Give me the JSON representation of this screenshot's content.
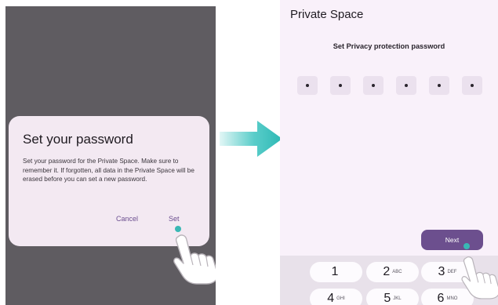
{
  "left_screen": {
    "dialog": {
      "title": "Set your password",
      "body": "Set your password for the Private Space. Make sure to remember it. If forgotten, all data in the Private Space will be erased before you can set a new password.",
      "cancel_label": "Cancel",
      "set_label": "Set"
    }
  },
  "right_screen": {
    "title": "Private Space",
    "subtitle": "Set Privacy protection password",
    "pin_length": 6,
    "next_label": "Next",
    "keypad": {
      "keys": [
        {
          "digit": "1",
          "letters": ""
        },
        {
          "digit": "2",
          "letters": "ABC"
        },
        {
          "digit": "3",
          "letters": "DEF"
        },
        {
          "digit": "4",
          "letters": "GHI"
        },
        {
          "digit": "5",
          "letters": "JKL"
        },
        {
          "digit": "6",
          "letters": "MNO"
        }
      ]
    }
  },
  "colors": {
    "accent": "#6c4f8e",
    "tap_indicator": "#39b8b4",
    "arrow": "#3cc4c0"
  },
  "icons": [
    "right-arrow-icon",
    "tap-hand-icon"
  ]
}
